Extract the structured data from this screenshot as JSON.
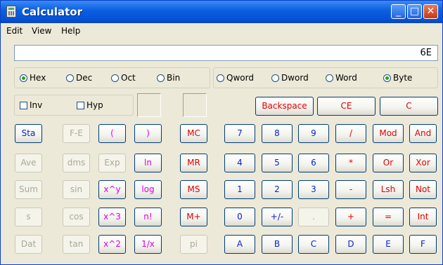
{
  "window": {
    "title": "Calculator"
  },
  "menu": [
    "Edit",
    "View",
    "Help"
  ],
  "display": {
    "value": "6E"
  },
  "radix": [
    {
      "label": "Hex",
      "selected": true
    },
    {
      "label": "Dec",
      "selected": false
    },
    {
      "label": "Oct",
      "selected": false
    },
    {
      "label": "Bin",
      "selected": false
    }
  ],
  "wordsize": [
    {
      "label": "Qword",
      "selected": false
    },
    {
      "label": "Dword",
      "selected": false
    },
    {
      "label": "Word",
      "selected": false
    },
    {
      "label": "Byte",
      "selected": true
    }
  ],
  "checks": [
    {
      "label": "Inv",
      "checked": false
    },
    {
      "label": "Hyp",
      "checked": false
    }
  ],
  "edit_buttons": [
    "Backspace",
    "CE",
    "C"
  ],
  "stat_buttons": [
    "Sta",
    "Ave",
    "Sum",
    "s",
    "Dat"
  ],
  "sci_col1": [
    "F-E",
    "dms",
    "sin",
    "cos",
    "tan"
  ],
  "sci_col2": [
    "(",
    "Exp",
    "x^y",
    "x^3",
    "x^2"
  ],
  "sci_col3": [
    ")",
    "ln",
    "log",
    "n!",
    "1/x"
  ],
  "mem_buttons": [
    "MC",
    "MR",
    "MS",
    "M+",
    "pi"
  ],
  "num_rows": [
    [
      "7",
      "8",
      "9",
      "/",
      "Mod",
      "And"
    ],
    [
      "4",
      "5",
      "6",
      "*",
      "Or",
      "Xor"
    ],
    [
      "1",
      "2",
      "3",
      "-",
      "Lsh",
      "Not"
    ],
    [
      "0",
      "+/-",
      ".",
      "+",
      "=",
      "Int"
    ],
    [
      "A",
      "B",
      "C",
      "D",
      "E",
      "F"
    ]
  ],
  "colors": {
    "digit": "#0a24c8",
    "operator": "#e00000",
    "function": "#e000e0",
    "disabled": "#aca899"
  }
}
